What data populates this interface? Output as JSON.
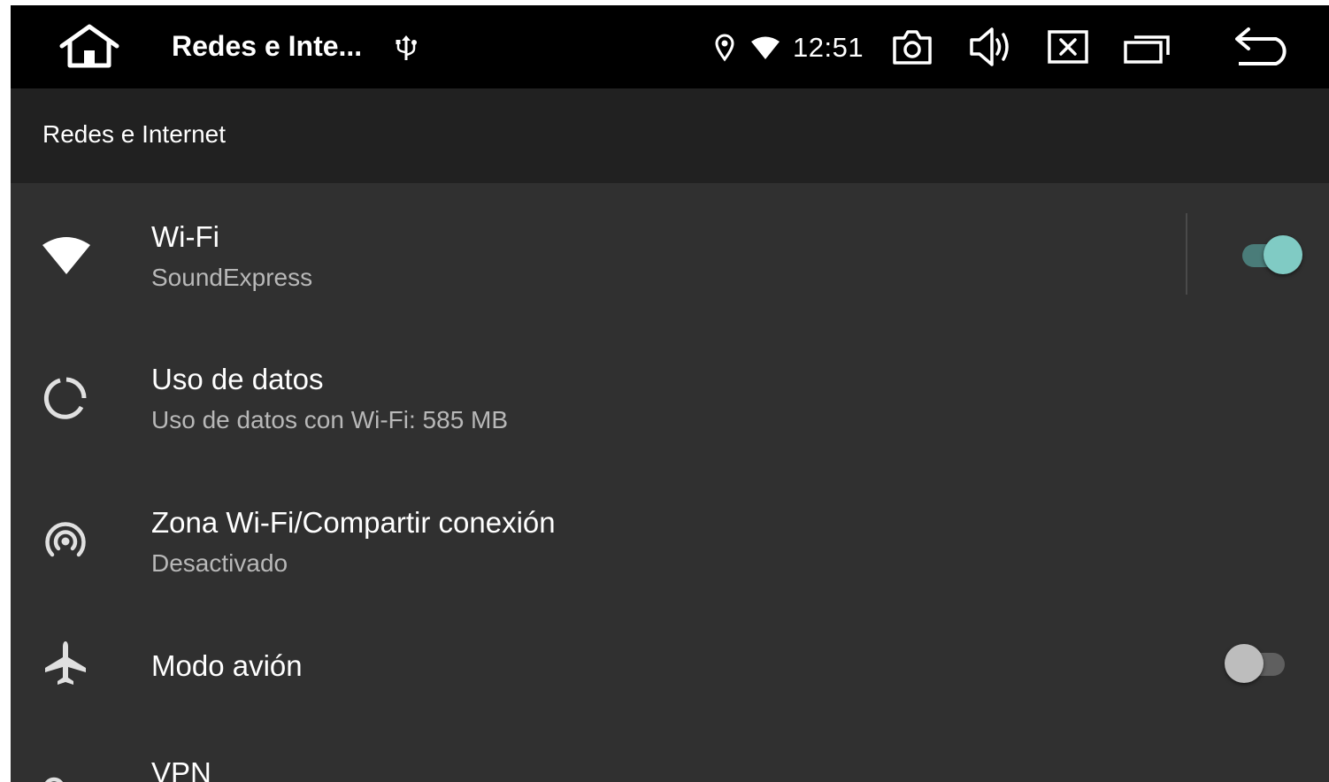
{
  "topbar": {
    "app_title": "Redes e Inte...",
    "time": "12:51",
    "icons": [
      "home-icon",
      "usb-icon",
      "location-icon",
      "wifi-status-icon",
      "camera-icon",
      "volume-icon",
      "close-app-icon",
      "recent-apps-icon",
      "back-icon"
    ]
  },
  "header": {
    "title": "Redes e Internet"
  },
  "accent_color": "#80cbc4",
  "items": [
    {
      "title": "Wi-Fi",
      "subtitle": "SoundExpress",
      "icon": "wifi-icon",
      "toggle": true
    },
    {
      "title": "Uso de datos",
      "subtitle": "Uso de datos con Wi-Fi: 585 MB",
      "icon": "data-usage-icon"
    },
    {
      "title": "Zona Wi-Fi/Compartir conexión",
      "subtitle": "Desactivado",
      "icon": "hotspot-icon"
    },
    {
      "title": "Modo avión",
      "icon": "airplane-icon",
      "toggle": false
    },
    {
      "title": "VPN",
      "icon": "vpn-key-icon"
    }
  ]
}
